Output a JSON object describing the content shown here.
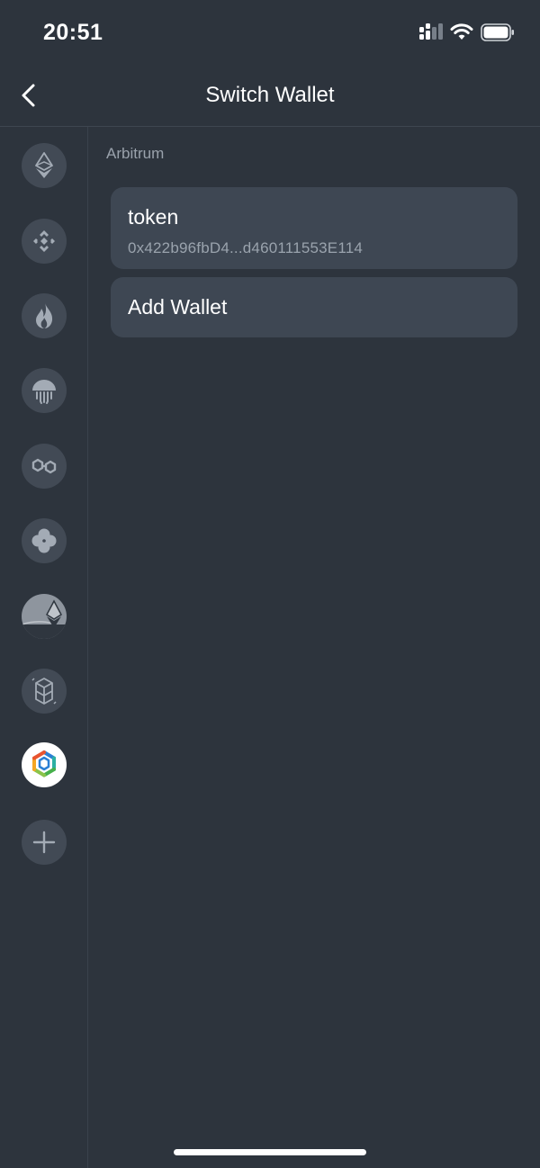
{
  "status_bar": {
    "time": "20:51"
  },
  "nav": {
    "title": "Switch Wallet"
  },
  "sidebar": {
    "chains": [
      {
        "icon": "ethereum-icon",
        "selected": false
      },
      {
        "icon": "bnb-chain-icon",
        "selected": false
      },
      {
        "icon": "heco-flame-icon",
        "selected": false
      },
      {
        "icon": "okc-jellyfish-icon",
        "selected": false
      },
      {
        "icon": "polygon-icon",
        "selected": false
      },
      {
        "icon": "clover-icon",
        "selected": false
      },
      {
        "icon": "optimism-ethereum-icon",
        "selected": false
      },
      {
        "icon": "fantom-icon",
        "selected": false
      },
      {
        "icon": "arbitrum-hexagon-icon",
        "selected": true
      }
    ],
    "add_icon": "plus-icon"
  },
  "main": {
    "section_label": "Arbitrum",
    "wallet": {
      "name": "token",
      "address": "0x422b96fbD4...d460111553E114"
    },
    "add_wallet_label": "Add Wallet"
  },
  "colors": {
    "background": "#2d343d",
    "card": "#3e4753",
    "icon_circle": "#424a55",
    "muted_text": "#9aa2ac"
  }
}
